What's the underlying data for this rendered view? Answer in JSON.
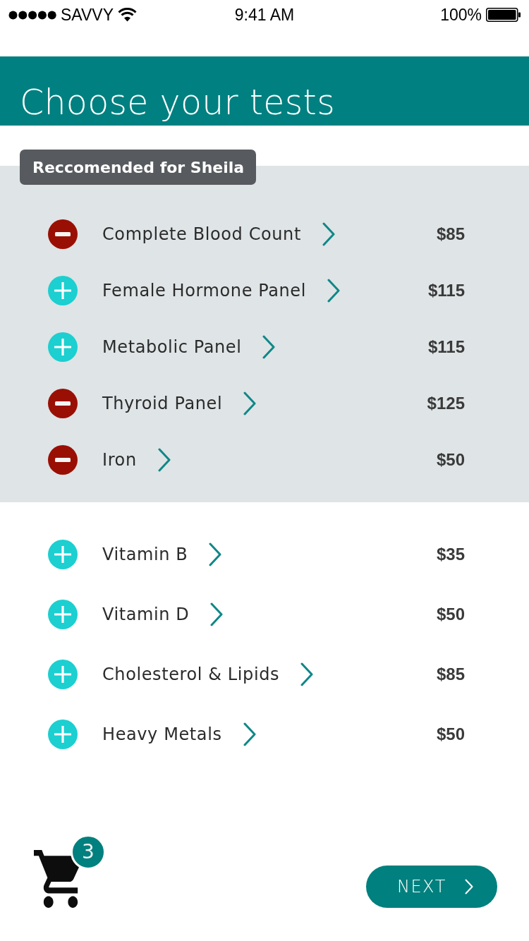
{
  "status_bar": {
    "carrier": "SAVVY",
    "time": "9:41 AM",
    "battery": "100%"
  },
  "header": {
    "title": "Choose your tests"
  },
  "recommended": {
    "label": "Reccomended for Sheila",
    "tests": [
      {
        "name": "Complete Blood Count",
        "price": "$85",
        "selected": true
      },
      {
        "name": "Female Hormone Panel",
        "price": "$115",
        "selected": false
      },
      {
        "name": "Metabolic Panel",
        "price": "$115",
        "selected": false
      },
      {
        "name": "Thyroid Panel",
        "price": "$125",
        "selected": true
      },
      {
        "name": "Iron",
        "price": "$50",
        "selected": true
      }
    ]
  },
  "other_tests": [
    {
      "name": "Vitamin B",
      "price": "$35",
      "selected": false
    },
    {
      "name": "Vitamin D",
      "price": "$50",
      "selected": false
    },
    {
      "name": "Cholesterol & Lipids",
      "price": "$85",
      "selected": false
    },
    {
      "name": "Heavy Metals",
      "price": "$50",
      "selected": false
    }
  ],
  "cart": {
    "count": "3"
  },
  "next_button": {
    "label": "NEXT"
  }
}
